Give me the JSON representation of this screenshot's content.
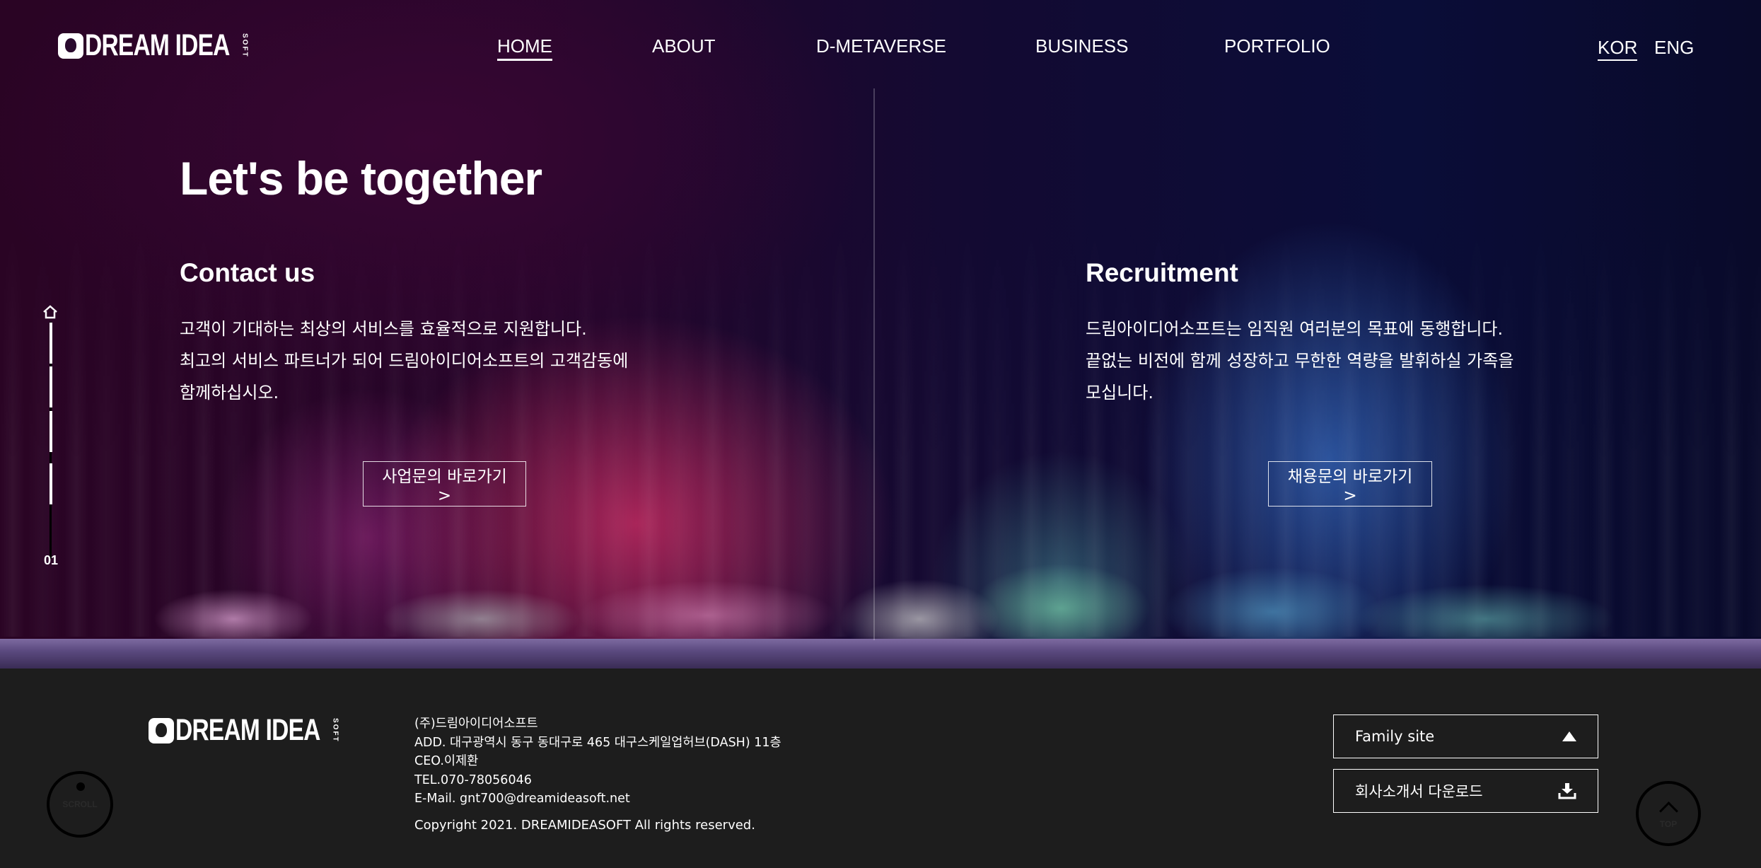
{
  "brand": {
    "logo_word": "DREAM IDEA",
    "logo_sub": "SOFT"
  },
  "nav": {
    "items": [
      {
        "label": "HOME",
        "active": true
      },
      {
        "label": "ABOUT",
        "active": false
      },
      {
        "label": "D-METAVERSE",
        "active": false
      },
      {
        "label": "BUSINESS",
        "active": false
      },
      {
        "label": "PORTFOLIO",
        "active": false
      }
    ]
  },
  "language": {
    "options": [
      {
        "label": "KOR",
        "active": true
      },
      {
        "label": "ENG",
        "active": false
      }
    ]
  },
  "hero": {
    "headline": "Let's be together",
    "contact": {
      "title": "Contact us",
      "lines": [
        "고객이 기대하는 최상의 서비스를 효율적으로 지원합니다.",
        "최고의 서비스 파트너가 되어 드림아이디어소프트의 고객감동에",
        "함께하십시오."
      ],
      "button": "사업문의 바로가기 >"
    },
    "recruit": {
      "title": "Recruitment",
      "lines": [
        "드림아이디어소프트는 임직원 여러분의 목표에 동행합니다.",
        "끝없는 비전에 함께 성장하고 무한한 역량을 발휘하실 가족을",
        "모십니다."
      ],
      "button": "채용문의 바로가기 >"
    }
  },
  "side_indicator": {
    "icon": "home-icon",
    "current_section": "01"
  },
  "footer": {
    "company": "(주)드림아이디어소프트",
    "address": "ADD. 대구광역시 동구 동대구로 465 대구스케일업허브(DASH) 11층",
    "ceo": "CEO.이제환",
    "tel": "TEL.070-78056046",
    "email": "E-Mail. gnt700@dreamideasoft.net",
    "copyright": "Copyright 2021. DREAMIDEASOFT All rights reserved.",
    "family_site": "Family site",
    "download": "회사소개서 다운로드",
    "scroll_label": "SCROLL",
    "top_label": "TOP"
  },
  "colors": {
    "footer_bg": "#1d1d1d",
    "hero_left": "#2a0424",
    "hero_right": "#090a2a",
    "aurora_pink": "#d73069",
    "aurora_blue": "#3c78d2"
  }
}
